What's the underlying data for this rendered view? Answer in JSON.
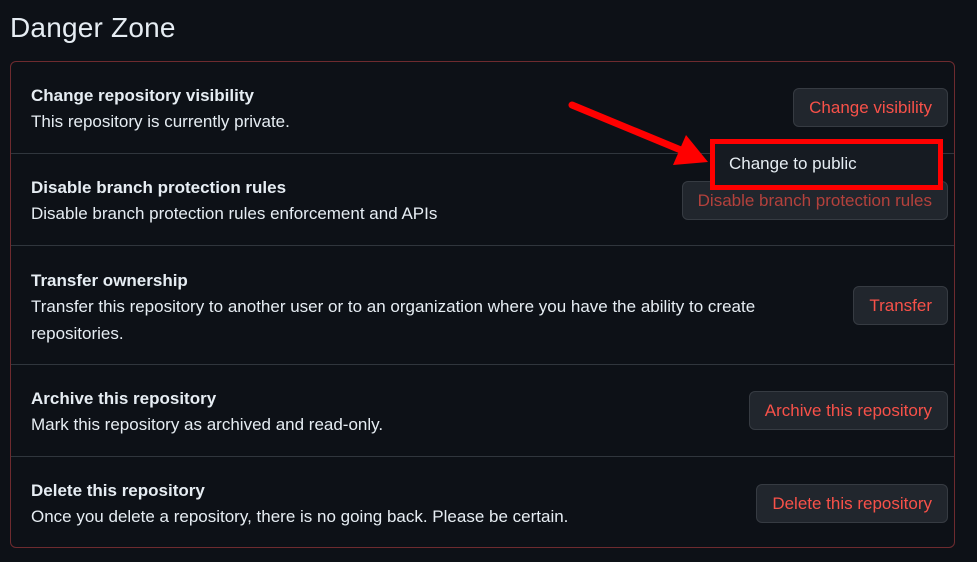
{
  "section": {
    "title": "Danger Zone"
  },
  "rows": [
    {
      "title": "Change repository visibility",
      "desc": "This repository is currently private.",
      "button": "Change visibility"
    },
    {
      "title": "Disable branch protection rules",
      "desc": "Disable branch protection rules enforcement and APIs",
      "button": "Disable branch protection rules"
    },
    {
      "title": "Transfer ownership",
      "desc": "Transfer this repository to another user or to an organization where you have the ability to create repositories.",
      "button": "Transfer"
    },
    {
      "title": "Archive this repository",
      "desc": "Mark this repository as archived and read-only.",
      "button": "Archive this repository"
    },
    {
      "title": "Delete this repository",
      "desc": "Once you delete a repository, there is no going back. Please be certain.",
      "button": "Delete this repository"
    }
  ],
  "visibility_menu": {
    "item": "Change to public"
  },
  "colors": {
    "background": "#0d1117",
    "danger_text": "#f85149",
    "danger_border": "#6e2b2f",
    "annotation": "#ff0000"
  }
}
